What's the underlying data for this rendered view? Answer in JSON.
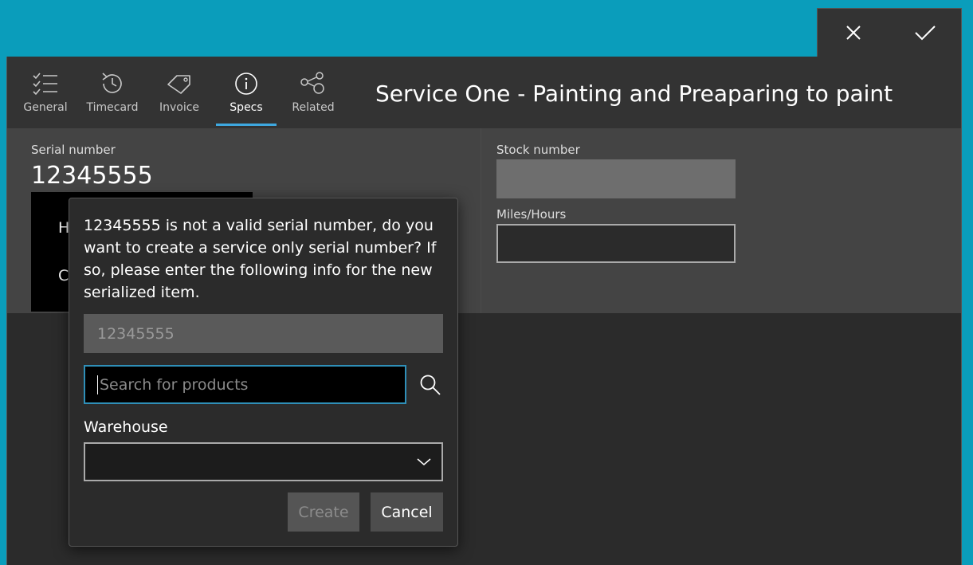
{
  "command_bar": {
    "close_icon": "close-icon",
    "accept_icon": "checkmark-icon"
  },
  "tabs": [
    {
      "label": "General",
      "icon": "checklist-icon"
    },
    {
      "label": "Timecard",
      "icon": "history-clock-icon"
    },
    {
      "label": "Invoice",
      "icon": "tag-icon"
    },
    {
      "label": "Specs",
      "icon": "info-icon",
      "active": true
    },
    {
      "label": "Related",
      "icon": "share-nodes-icon"
    }
  ],
  "title": "Service One - Painting and Preaparing to paint",
  "specs": {
    "serial_label": "Serial number",
    "serial_value": "12345555",
    "black_panel_line1": "H",
    "black_panel_line2": "C",
    "stock_label": "Stock number",
    "stock_value": "",
    "miles_label": "Miles/Hours",
    "miles_value": ""
  },
  "dialog": {
    "message": "12345555 is not a valid serial number, do you want to create a service only serial number? If so, please enter the following info for the new serialized item.",
    "serial_value": "12345555",
    "search_placeholder": "Search for products",
    "warehouse_label": "Warehouse",
    "warehouse_value": "",
    "create_label": "Create",
    "cancel_label": "Cancel"
  },
  "colors": {
    "accent": "#3ea8e0",
    "background": "#0a9dbb",
    "window": "#2b2b2b"
  }
}
